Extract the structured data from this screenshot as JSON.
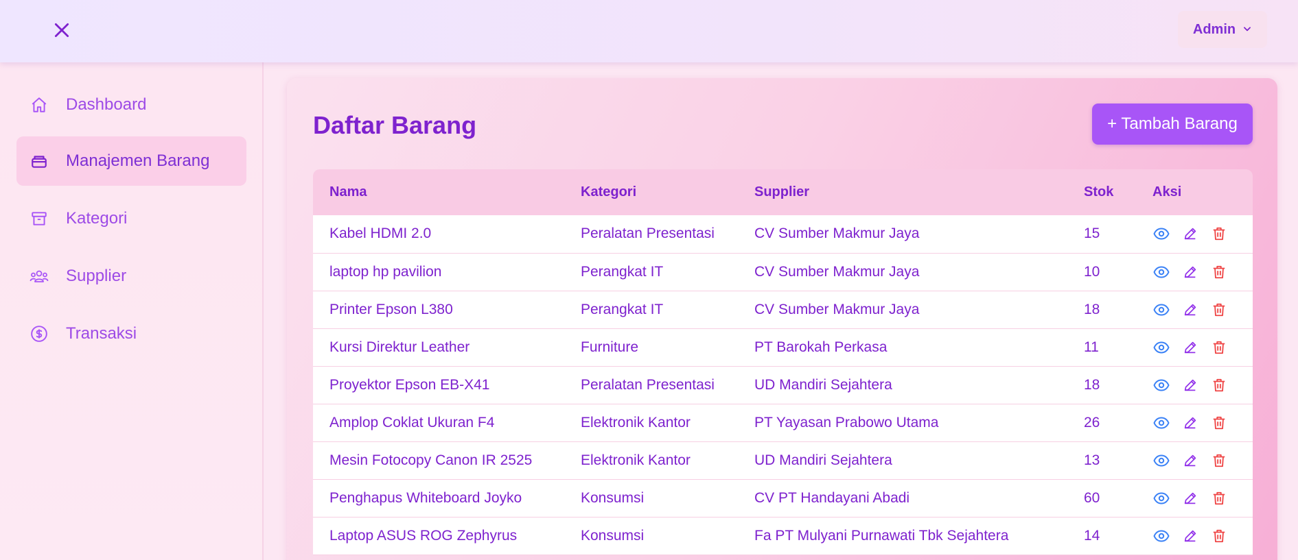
{
  "header": {
    "menu_icon": "close-icon",
    "user_label": "Admin",
    "user_menu_icon": "chevron-down-icon"
  },
  "sidebar": {
    "items": [
      {
        "label": "Dashboard",
        "icon": "home-icon",
        "active": false
      },
      {
        "label": "Manajemen Barang",
        "icon": "box-icon",
        "active": true
      },
      {
        "label": "Kategori",
        "icon": "archive-icon",
        "active": false
      },
      {
        "label": "Supplier",
        "icon": "users-icon",
        "active": false
      },
      {
        "label": "Transaksi",
        "icon": "dollar-icon",
        "active": false
      }
    ]
  },
  "main": {
    "title": "Daftar Barang",
    "add_button_label": "+ Tambah Barang",
    "table": {
      "columns": [
        "Nama",
        "Kategori",
        "Supplier",
        "Stok",
        "Aksi"
      ],
      "rows": [
        {
          "nama": "Kabel HDMI 2.0",
          "kategori": "Peralatan Presentasi",
          "supplier": "CV Sumber Makmur Jaya",
          "stok": "15"
        },
        {
          "nama": "laptop hp pavilion",
          "kategori": "Perangkat IT",
          "supplier": "CV Sumber Makmur Jaya",
          "stok": "10"
        },
        {
          "nama": "Printer Epson L380",
          "kategori": "Perangkat IT",
          "supplier": "CV Sumber Makmur Jaya",
          "stok": "18"
        },
        {
          "nama": "Kursi Direktur Leather",
          "kategori": "Furniture",
          "supplier": "PT Barokah Perkasa",
          "stok": "11"
        },
        {
          "nama": "Proyektor Epson EB-X41",
          "kategori": "Peralatan Presentasi",
          "supplier": "UD Mandiri Sejahtera",
          "stok": "18"
        },
        {
          "nama": "Amplop Coklat Ukuran F4",
          "kategori": "Elektronik Kantor",
          "supplier": "PT Yayasan Prabowo Utama",
          "stok": "26"
        },
        {
          "nama": "Mesin Fotocopy Canon IR 2525",
          "kategori": "Elektronik Kantor",
          "supplier": "UD Mandiri Sejahtera",
          "stok": "13"
        },
        {
          "nama": "Penghapus Whiteboard Joyko",
          "kategori": "Konsumsi",
          "supplier": "CV PT Handayani Abadi",
          "stok": "60"
        },
        {
          "nama": "Laptop ASUS ROG Zephyrus",
          "kategori": "Konsumsi",
          "supplier": "Fa PT Mulyani Purnawati Tbk Sejahtera",
          "stok": "14"
        }
      ],
      "row_actions": [
        "eye-icon",
        "pencil-icon",
        "trash-icon"
      ]
    }
  },
  "colors": {
    "accent": "#7e22ce",
    "button": "#a855f7",
    "view_icon": "#3b82f6",
    "edit_icon": "#9333ea",
    "delete_icon": "#ef4444"
  }
}
